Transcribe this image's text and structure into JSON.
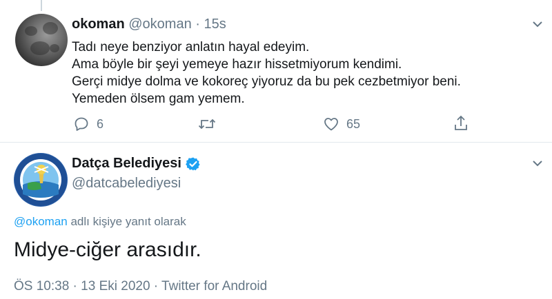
{
  "tweet": {
    "author_name": "okoman",
    "author_handle": "@okoman",
    "separator": "·",
    "time_ago": "15s",
    "lines": [
      "Tadı neye benziyor anlatın hayal edeyim.",
      "Ama böyle bir şeyi yemeye hazır hissetmiyorum kendimi.",
      "Gerçi midye dolma ve kokoreç yiyoruz da bu pek cezbetmiyor beni.",
      "Yemeden ölsem gam yemem."
    ],
    "actions": {
      "reply_icon": "reply-icon",
      "reply_count": "6",
      "retweet_icon": "retweet-icon",
      "like_icon": "heart-icon",
      "like_count": "65",
      "share_icon": "share-icon"
    }
  },
  "reply": {
    "author_name": "Datça Belediyesi",
    "verified_icon": "verified-badge-icon",
    "author_handle": "@datcabelediyesi",
    "replying_to_handle": "@okoman",
    "replying_to_suffix": " adlı kişiye yanıt olarak",
    "text": "Midye-ciğer arasıdır.",
    "meta": "ÖS 10:38 · 13 Eki 2020 · Twitter for Android"
  },
  "colors": {
    "link": "#1da1f2",
    "muted": "#657786",
    "text": "#14171a",
    "divider": "#e1e8ed",
    "verified": "#1da1f2"
  }
}
